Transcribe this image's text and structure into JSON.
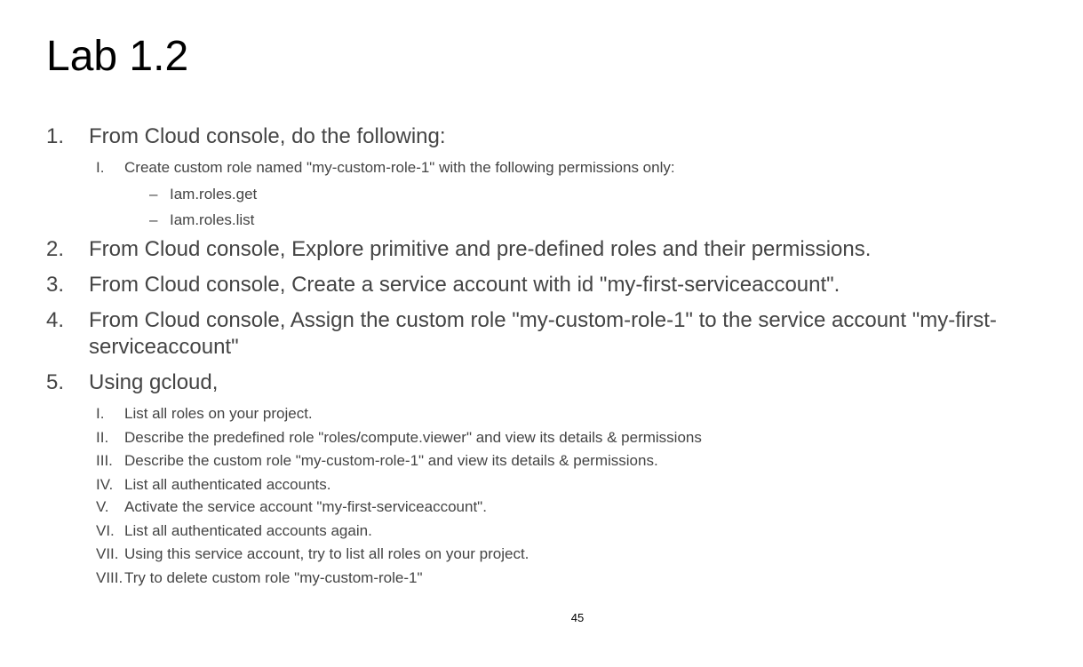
{
  "title": "Lab 1.2",
  "items": [
    {
      "num": "1.",
      "text": "From Cloud console, do the following:",
      "sub": [
        {
          "num": "I.",
          "text": "Create custom role named \"my-custom-role-1\" with the following permissions only:",
          "sub": [
            {
              "num": "–",
              "text": "Iam.roles.get"
            },
            {
              "num": "–",
              "text": "Iam.roles.list"
            }
          ]
        }
      ]
    },
    {
      "num": "2.",
      "text": "From Cloud console, Explore primitive and pre-defined roles and their permissions."
    },
    {
      "num": "3.",
      "text": "From Cloud console, Create a service account with id \"my-first-serviceaccount\"."
    },
    {
      "num": "4.",
      "text": "From Cloud console, Assign the custom role \"my-custom-role-1\" to the service account \"my-first-serviceaccount\""
    },
    {
      "num": "5.",
      "text": "Using gcloud,",
      "sub": [
        {
          "num": "I.",
          "text": "List all roles on your project."
        },
        {
          "num": "II.",
          "text": "Describe the predefined role \"roles/compute.viewer\" and view its details & permissions"
        },
        {
          "num": "III.",
          "text": "Describe the custom role \"my-custom-role-1\" and view its details & permissions."
        },
        {
          "num": "IV.",
          "text": "List all authenticated accounts."
        },
        {
          "num": "V.",
          "text": "Activate the service account \"my-first-serviceaccount\"."
        },
        {
          "num": "VI.",
          "text": "List all authenticated accounts again."
        },
        {
          "num": "VII.",
          "text": "Using this service account, try to list all roles on your project."
        },
        {
          "num": "VIII.",
          "text": "Try to delete custom role \"my-custom-role-1\""
        }
      ]
    }
  ],
  "page_number": "45"
}
